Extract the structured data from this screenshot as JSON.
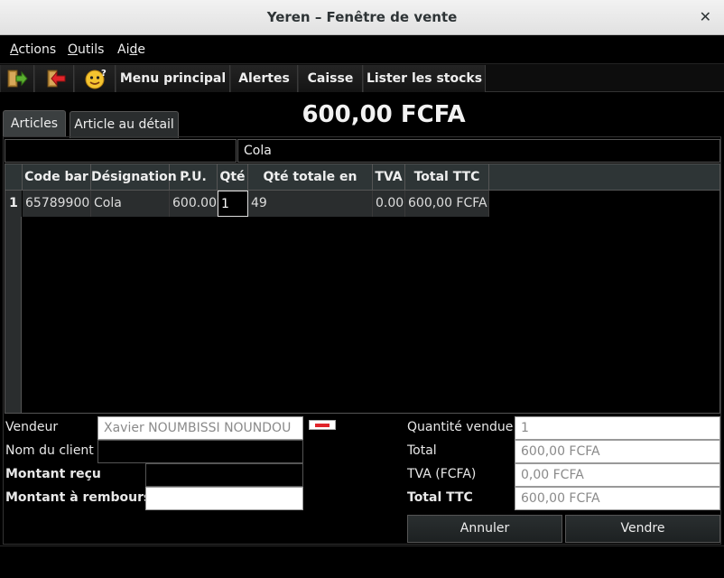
{
  "window": {
    "title": "Yeren – Fenêtre de vente",
    "close_glyph": "✕"
  },
  "menubar": {
    "items": [
      {
        "label": "Actions",
        "mnemonic": "A",
        "rest": "ctions"
      },
      {
        "label": "Outils",
        "mnemonic": "O",
        "rest": "utils"
      },
      {
        "label": "Aide",
        "prefix": "Ai",
        "mnemonic": "d",
        "rest": "e"
      }
    ]
  },
  "toolbar": {
    "icons": [
      "exit-right-icon",
      "exit-left-icon",
      "help-smiley-icon"
    ],
    "buttons": [
      "Menu principal",
      "Alertes",
      "Caisse",
      "Lister les stocks"
    ]
  },
  "tabs": [
    {
      "label": "Articles",
      "active": true
    },
    {
      "label": "Article au détail",
      "active": false
    }
  ],
  "total_display": "600,00 FCFA",
  "search": {
    "left_value": "",
    "right_value": "Cola"
  },
  "table": {
    "columns": [
      "Code bar",
      "Désignation",
      "P.U.",
      "Qté",
      "Qté totale en stock",
      "TVA",
      "Total TTC"
    ],
    "rows": [
      {
        "num": "1",
        "code": "65789900",
        "designation": "Cola",
        "pu": "600.00",
        "qte": "1",
        "stock": "49",
        "tva": "0.00",
        "total": "600,00 FCFA"
      }
    ]
  },
  "form": {
    "vendeur_label": "Vendeur",
    "vendeur_value": "Xavier NOUMBISSI NOUNDOU",
    "client_label": "Nom du client",
    "client_value": "",
    "montant_recu_label": "Montant reçu",
    "montant_recu_value": "",
    "montant_rembourser_label": "Montant à rembourser",
    "montant_rembourser_value": ""
  },
  "summary": {
    "quantite_label": "Quantité vendue",
    "quantite_value": "1",
    "total_label": "Total",
    "total_value": "600,00 FCFA",
    "tva_label": "TVA (FCFA)",
    "tva_value": "0,00 FCFA",
    "ttc_label": "Total TTC",
    "ttc_value": "600,00 FCFA"
  },
  "actions": {
    "cancel": "Annuler",
    "sell": "Vendre"
  },
  "colors": {
    "accent_red": "#e0242a",
    "background": "#000000",
    "cell_bg": "#2a2d2e"
  }
}
